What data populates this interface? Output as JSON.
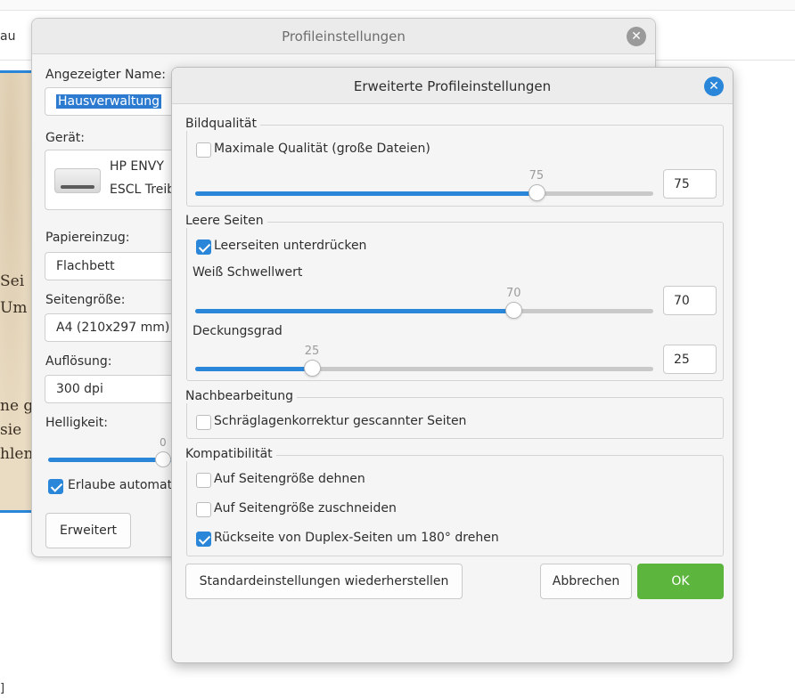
{
  "background": {
    "toolbar_fragment": "au",
    "bottom_fragment": "]",
    "scan_lines": [
      "Sei",
      "Um",
      "ne g",
      "sie",
      "hlen"
    ]
  },
  "profile_window": {
    "title": "Profileinstellungen",
    "close_glyph": "✕",
    "name_label": "Angezeigter Name:",
    "name_value": "Hausverwaltung",
    "device_label": "Gerät:",
    "device_line1": "HP ENVY",
    "device_line2": "ESCL Treib",
    "paper_source_label": "Papiereinzug:",
    "paper_source_value": "Flachbett",
    "page_size_label": "Seitengröße:",
    "page_size_value": "A4 (210x297 mm)",
    "resolution_label": "Auflösung:",
    "resolution_value": "300 dpi",
    "brightness_label": "Helligkeit:",
    "brightness_value": "0",
    "allow_auto_label": "Erlaube automat",
    "allow_auto_checked": true,
    "advanced_button": "Erweitert"
  },
  "advanced_dialog": {
    "title": "Erweiterte Profileinstellungen",
    "close_glyph": "✕",
    "image_quality": {
      "title": "Bildqualität",
      "max_quality_label": "Maximale Qualität (große Dateien)",
      "max_quality_checked": false,
      "slider_value": 75,
      "slider_fraction": 0.745,
      "spin_value": "75"
    },
    "blank_pages": {
      "title": "Leere Seiten",
      "suppress_label": "Leerseiten unterdrücken",
      "suppress_checked": true,
      "white_threshold_label": "Weiß Schwellwert",
      "white_threshold_value": 70,
      "white_threshold_fraction": 0.695,
      "white_threshold_spin": "70",
      "coverage_label": "Deckungsgrad",
      "coverage_value": 25,
      "coverage_fraction": 0.255,
      "coverage_spin": "25"
    },
    "post_processing": {
      "title": "Nachbearbeitung",
      "deskew_label": "Schräglagenkorrektur gescannter Seiten",
      "deskew_checked": false
    },
    "compatibility": {
      "title": "Kompatibilität",
      "stretch_label": "Auf Seitengröße dehnen",
      "stretch_checked": false,
      "crop_label": "Auf Seitengröße zuschneiden",
      "crop_checked": false,
      "rotate_label": "Rückseite von Duplex-Seiten um 180° drehen",
      "rotate_checked": true
    },
    "buttons": {
      "restore_defaults": "Standardeinstellungen wiederherstellen",
      "cancel": "Abbrechen",
      "ok": "OK"
    },
    "colors": {
      "accent": "#2a86d8",
      "ok_green": "#5cb53c"
    }
  }
}
